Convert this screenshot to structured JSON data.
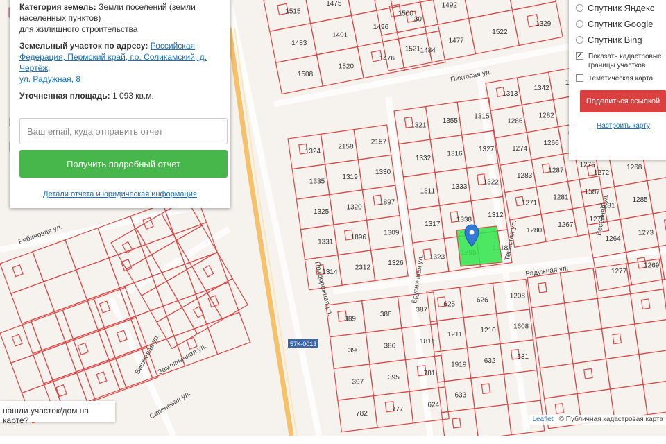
{
  "info_panel": {
    "category_label": "Категория земель:",
    "category_value_1": "Земли поселений (земли",
    "category_value_2": "населенных пунктов)",
    "category_value_3": "для жилищного строительства",
    "address_label": "Земельный участок по адресу:",
    "address_line_1": "Российская",
    "address_line_2": "Федерация, Пермский край, г.о. Соликамский, д. Чертёж,",
    "address_line_3": "ул. Радужная, 8",
    "area_label": "Уточненная площадь:",
    "area_value": "1 093 кв.м.",
    "email_placeholder": "Ваш email, куда отправить отчет",
    "report_button": "Получить подробный отчет",
    "details_link": "Детали отчета и юридическая информация"
  },
  "layers_panel": {
    "options": [
      "Спутник Яндекс",
      "Спутник Google",
      "Спутник Bing"
    ],
    "show_cadastral_1": "Показать кадастровые",
    "show_cadastral_2": "границы участков",
    "thematic_map": "Тематическая карта",
    "share_button": "Поделиться ссылкой",
    "configure_link": "Настроить карту"
  },
  "hint": "нашли участок/дом на карте?",
  "road_sign": "57К-0013",
  "attribution": {
    "leaflet": "Leaflet",
    "text": "| © Публичная кадастровая карта"
  },
  "street_labels": {
    "pikhtovaya": "Пихтовая ул.",
    "radugnaya": "Радужная ул.",
    "brusnichnaya": "Брусничная ул.",
    "prigorodnaya": "Придорожная ул.",
    "ryabinovaya": "Рябиновая ул.",
    "vishnevaya": "Вишневая ул.",
    "vesennyaya": "Весенняя ул.",
    "tenistaya": "Тенистая ул.",
    "sirenevaya": "Сиреневая ул.",
    "zemlyanichnaya": "Земляничная ул."
  },
  "parcel_labels": [
    "1515",
    "1475",
    "1483",
    "1491",
    "1496",
    "30",
    "1508",
    "1520",
    "1476",
    "1484",
    "1500",
    "1492",
    "1521",
    "1477",
    "1522",
    "1329",
    "1324",
    "2158",
    "2157",
    "1335",
    "1319",
    "1330",
    "1325",
    "1320",
    "1897",
    "1331",
    "1896",
    "1309",
    "1314",
    "2312",
    "1326",
    "1321",
    "1355",
    "1315",
    "1332",
    "1316",
    "1327",
    "1311",
    "1333",
    "1322",
    "1317",
    "1338",
    "1312",
    "1323",
    "1895",
    "1318",
    "1313",
    "1342",
    "1343",
    "1286",
    "1282",
    "1270",
    "1274",
    "1266",
    "1279",
    "1283",
    "1287",
    "1275",
    "1271",
    "1281",
    "1587",
    "1280",
    "1267",
    "1276",
    "1272",
    "1268",
    "1281",
    "1285",
    "1264",
    "1273",
    "1277",
    "1269",
    "389",
    "388",
    "387",
    "390",
    "386",
    "1811",
    "397",
    "395",
    "781",
    "782",
    "777",
    "624",
    "625",
    "626",
    "1208",
    "1211",
    "1210",
    "1608",
    "1919",
    "632",
    "631",
    "633"
  ],
  "colors": {
    "parcel_stroke": "#d94848",
    "selected_parcel": "#2ee54a",
    "marker": "#2f7bd6",
    "road_orange": "#f5c26b",
    "share_button": "#d9403f",
    "report_button": "#48b74b"
  }
}
